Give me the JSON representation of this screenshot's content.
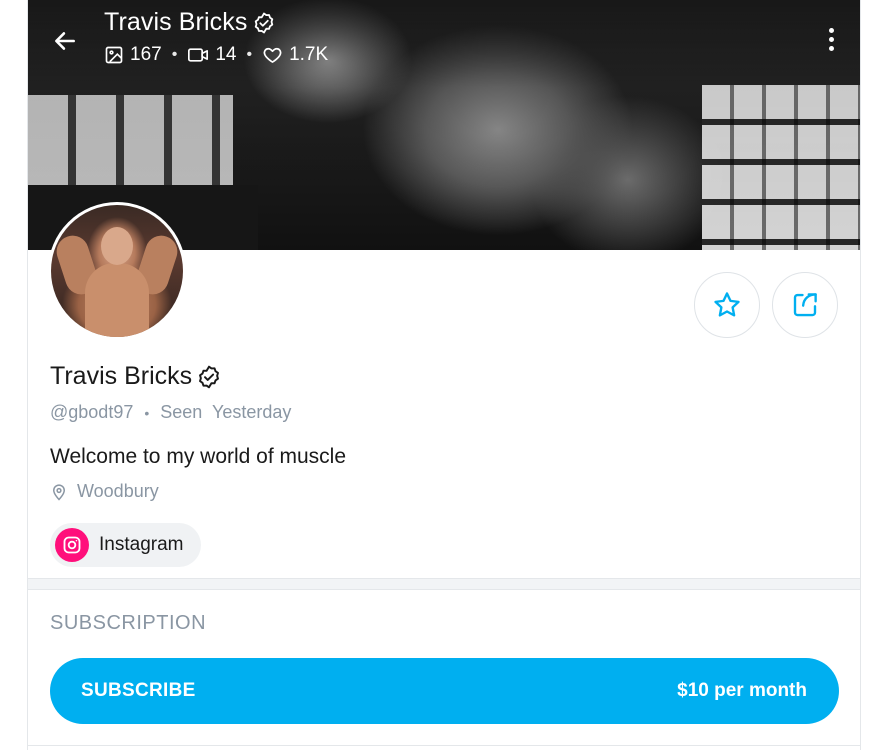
{
  "header": {
    "title": "Travis Bricks",
    "stats": {
      "photos": "167",
      "videos": "14",
      "likes": "1.7K"
    }
  },
  "profile": {
    "name": "Travis Bricks",
    "handle": "@gbodt97",
    "last_seen": "Seen  Yesterday",
    "bio": "Welcome to my world of muscle",
    "location": "Woodbury"
  },
  "social": {
    "instagram_label": "Instagram"
  },
  "subscription": {
    "section_title": "SUBSCRIPTION",
    "button_label": "SUBSCRIBE",
    "price": "$10 per month"
  },
  "icons": {
    "back": "arrow-left-icon",
    "verified": "verified-badge-icon",
    "photos": "image-icon",
    "videos": "video-icon",
    "likes": "heart-icon",
    "more": "more-vertical-icon",
    "favorite": "star-icon",
    "share": "share-icon",
    "location": "location-pin-icon",
    "instagram": "instagram-icon"
  },
  "colors": {
    "accent": "#00aff0",
    "muted_text": "#8a96a3",
    "instagram": "#ff0f7b"
  }
}
